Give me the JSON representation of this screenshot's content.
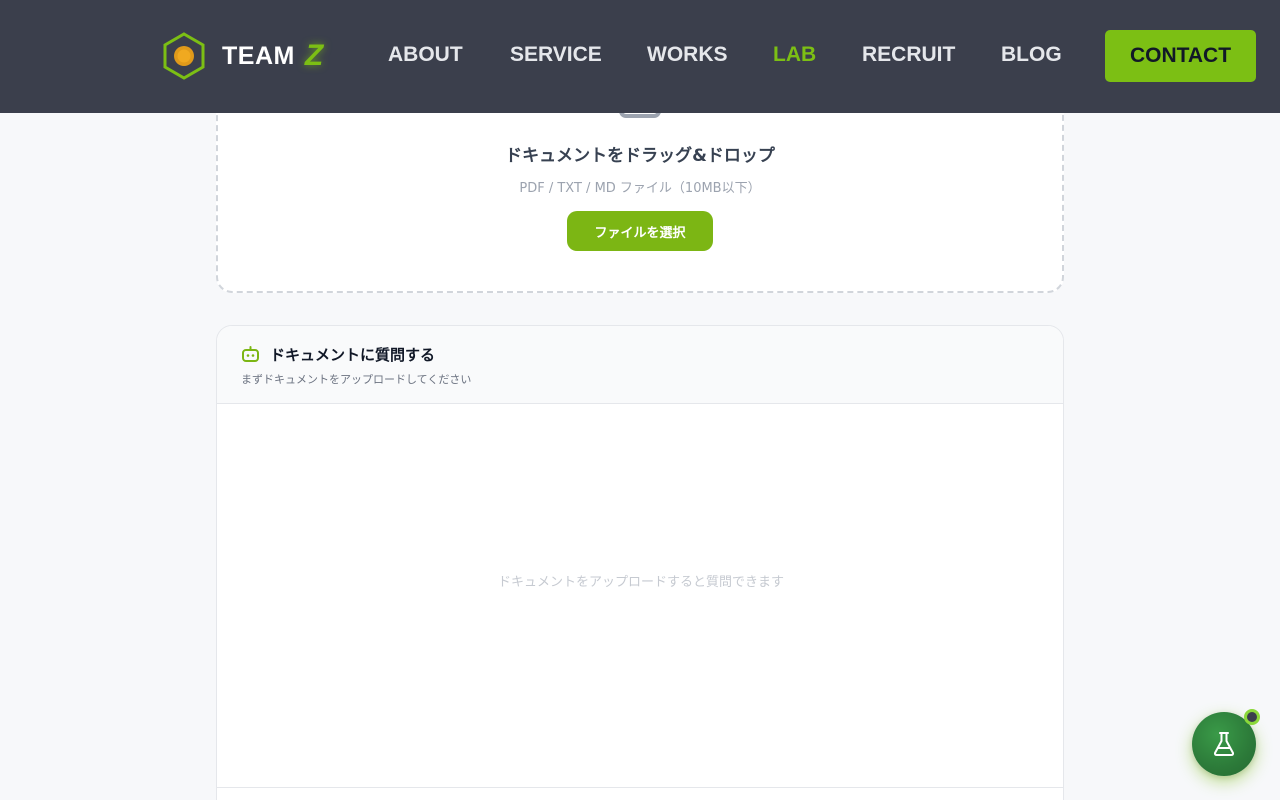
{
  "header": {
    "logo_text": "TEAM",
    "logo_accent": "Z",
    "nav": [
      {
        "label": "ABOUT"
      },
      {
        "label": "SERVICE"
      },
      {
        "label": "WORKS"
      },
      {
        "label": "LAB",
        "active": true
      },
      {
        "label": "RECRUIT"
      },
      {
        "label": "BLOG"
      }
    ],
    "contact_label": "CONTACT"
  },
  "upload": {
    "icon": "document-icon",
    "title": "ドキュメントをドラッグ&ドロップ",
    "hint": "PDF / TXT / MD ファイル（10MB以下）",
    "button_label": "ファイルを選択"
  },
  "chat": {
    "icon": "robot-icon",
    "title": "ドキュメントに質問する",
    "subtitle": "まずドキュメントをアップロードしてください",
    "empty_message": "ドキュメントをアップロードすると質問できます"
  },
  "fab": {
    "icon": "flask-icon"
  },
  "colors": {
    "header_bg": "#3b3f4c",
    "accent": "#7cbf14",
    "page_bg": "#f7f8fa",
    "fab_green": "#2c7a39"
  }
}
